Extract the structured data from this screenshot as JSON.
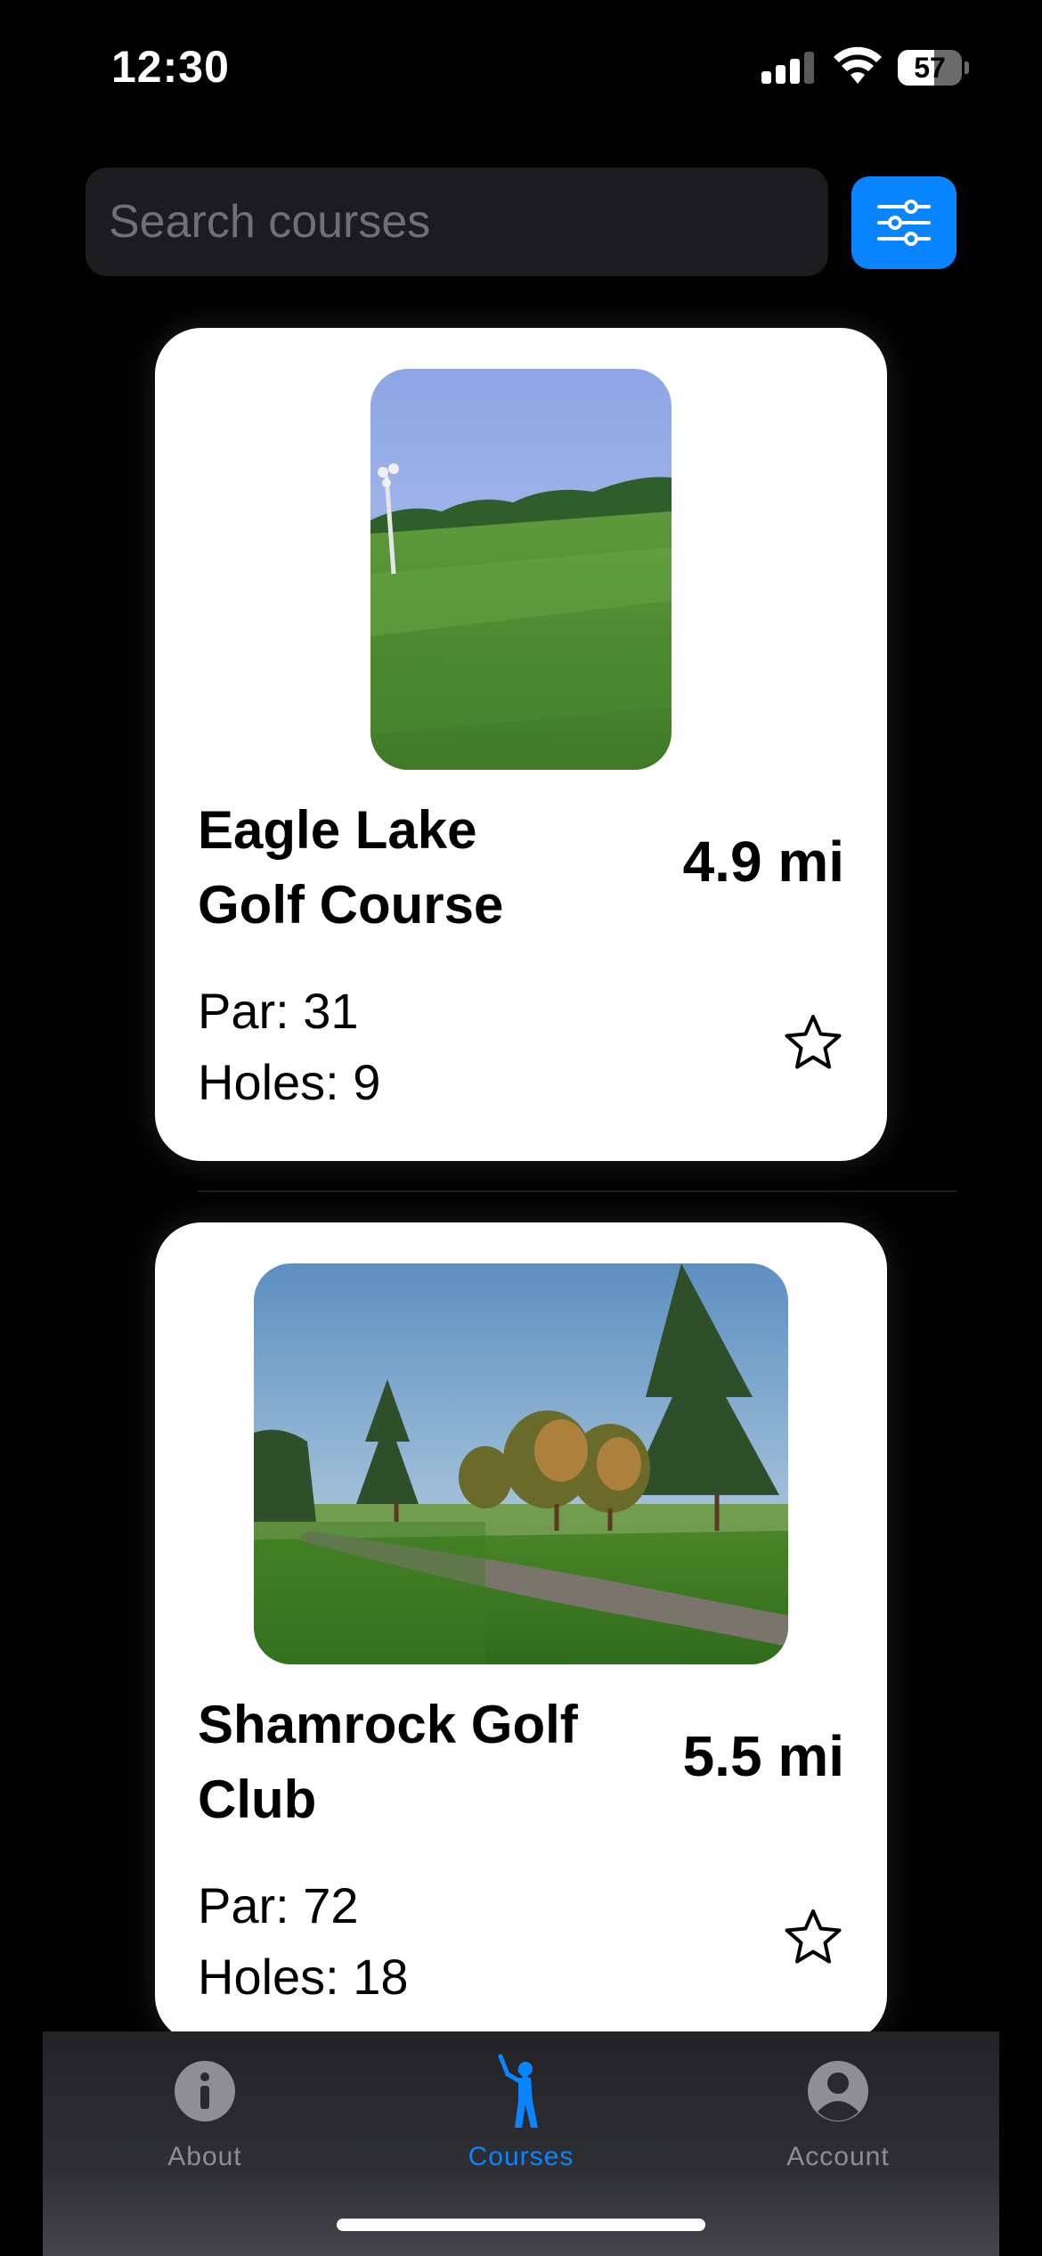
{
  "status_bar": {
    "time": "12:30",
    "battery_level": "57",
    "battery_percent": 57,
    "signal_bars": 3,
    "icons": [
      "cellular-signal-icon",
      "wifi-icon",
      "battery-icon"
    ]
  },
  "search": {
    "placeholder": "Search courses",
    "value": ""
  },
  "filter": {
    "icon": "sliders-icon",
    "color": "#0a84ff"
  },
  "courses": [
    {
      "name": "Eagle Lake Golf Course",
      "distance": "4.9 mi",
      "par": "Par: 31",
      "holes": "Holes: 9",
      "favorite": false,
      "favorite_icon": "star-outline-icon"
    },
    {
      "name": "Shamrock Golf Club",
      "distance": "5.5 mi",
      "par": "Par: 72",
      "holes": "Holes: 18",
      "favorite": false,
      "favorite_icon": "star-outline-icon"
    }
  ],
  "tabs": [
    {
      "label": "About",
      "icon": "info-icon",
      "selected": false
    },
    {
      "label": "Courses",
      "icon": "golfer-icon",
      "selected": true
    },
    {
      "label": "Account",
      "icon": "person-circle-icon",
      "selected": false
    }
  ],
  "colors": {
    "accent": "#0a84ff",
    "background": "#000000",
    "card": "#ffffff",
    "tab_inactive": "#8e8e93"
  }
}
